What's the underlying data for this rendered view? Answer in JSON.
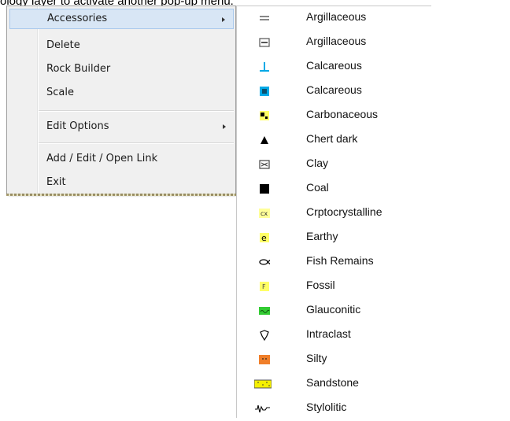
{
  "caption": "ology layer to activate another pop-up menu.",
  "menu": {
    "items": [
      {
        "label": "Accessories",
        "submenu": true,
        "highlighted": true
      },
      {
        "label": "Delete"
      },
      {
        "label": "Rock Builder"
      },
      {
        "label": "Scale"
      },
      {
        "label": "Edit Options",
        "submenu": true
      },
      {
        "label": "Add / Edit / Open Link"
      },
      {
        "label": "Exit"
      }
    ]
  },
  "submenu": {
    "items": [
      {
        "label": "Argillaceous",
        "icon": "argillaceous-dash-icon"
      },
      {
        "label": "Argillaceous",
        "icon": "argillaceous-box-icon"
      },
      {
        "label": "Calcareous",
        "icon": "calcareous-t-icon",
        "color": "#00a9e6"
      },
      {
        "label": "Calcareous",
        "icon": "calcareous-box-icon",
        "color": "#00a9e6"
      },
      {
        "label": "Carbonaceous",
        "icon": "carbonaceous-icon",
        "color": "#ffff66"
      },
      {
        "label": "Chert dark",
        "icon": "triangle-icon"
      },
      {
        "label": "Clay",
        "icon": "clay-icon"
      },
      {
        "label": "Coal",
        "icon": "black-square-icon"
      },
      {
        "label": "Crptocrystalline",
        "icon": "cryptocrystalline-icon",
        "color": "#ffff99"
      },
      {
        "label": "Earthy",
        "icon": "earthy-e-icon",
        "color": "#ffff66"
      },
      {
        "label": "Fish Remains",
        "icon": "fish-icon"
      },
      {
        "label": "Fossil",
        "icon": "fossil-f-icon",
        "color": "#ffff66"
      },
      {
        "label": "Glauconitic",
        "icon": "glauconitic-icon",
        "color": "#33cc33"
      },
      {
        "label": "Intraclast",
        "icon": "intraclast-icon"
      },
      {
        "label": "Silty",
        "icon": "silty-icon",
        "color": "#f07f2a"
      },
      {
        "label": "Sandstone",
        "icon": "sandstone-icon",
        "color": "#f5f000"
      },
      {
        "label": "Stylolitic",
        "icon": "stylolitic-icon"
      }
    ]
  }
}
